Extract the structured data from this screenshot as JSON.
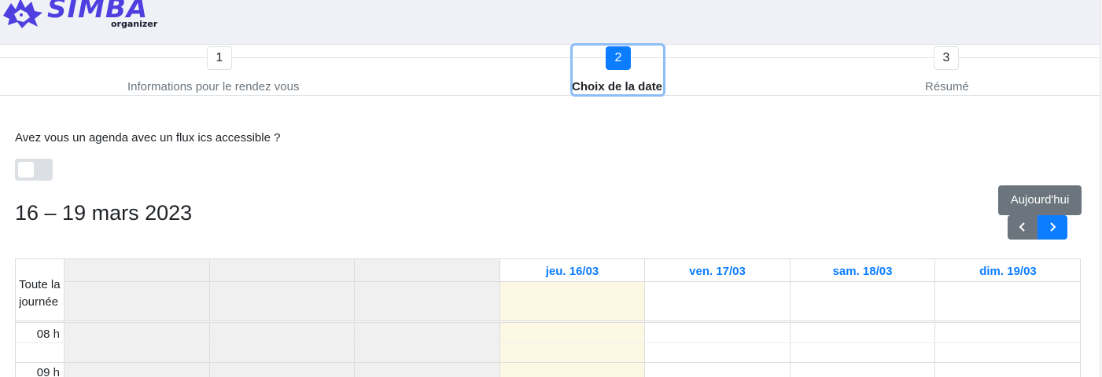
{
  "app": {
    "brand": "SIMBA",
    "brand_sub": "organizer",
    "brand_color": "#4f3fe0"
  },
  "stepper": {
    "steps": [
      {
        "number": "1",
        "label": "Informations pour le rendez vous",
        "state": "done"
      },
      {
        "number": "2",
        "label": "Choix de la date",
        "state": "active"
      },
      {
        "number": "3",
        "label": "Résumé",
        "state": "pending"
      }
    ]
  },
  "form": {
    "ics_question": "Avez vous un agenda avec un flux ics accessible ?",
    "ics_toggle_on": false
  },
  "calendar": {
    "title": "16 – 19 mars 2023",
    "today_label": "Aujourd'hui",
    "prev_icon": "chevron-left-icon",
    "next_icon": "chevron-right-icon",
    "accent_color": "#0d7dff",
    "days": [
      {
        "label": "",
        "state": "past"
      },
      {
        "label": "",
        "state": "past"
      },
      {
        "label": "",
        "state": "past"
      },
      {
        "label": "jeu. 16/03",
        "state": "today"
      },
      {
        "label": "ven. 17/03",
        "state": "future"
      },
      {
        "label": "sam. 18/03",
        "state": "future"
      },
      {
        "label": "dim. 19/03",
        "state": "future"
      }
    ],
    "all_day_label": "Toute la journée",
    "hours": [
      "08 h",
      "09 h"
    ]
  }
}
